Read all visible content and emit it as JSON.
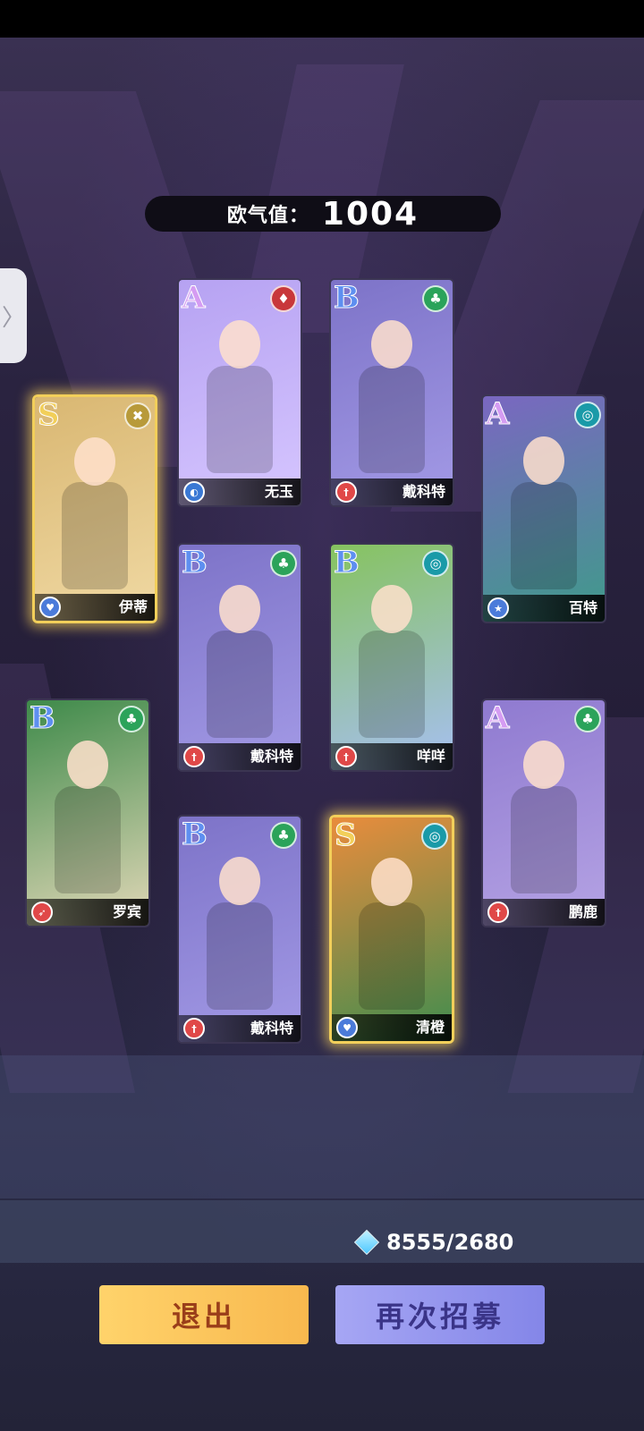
{
  "luck": {
    "label": "欧气值：",
    "value": "1004"
  },
  "cards": [
    {
      "rank": "A",
      "name": "无玉",
      "rank_color": "#d59cf2",
      "element": "fire",
      "element_color": "#c8373a",
      "class": "guard",
      "class_color": "#3a78d4",
      "art": [
        "#b6a2f2",
        "#d6c6ff"
      ]
    },
    {
      "rank": "B",
      "name": "戴科特",
      "rank_color": "#5e8ff0",
      "element": "nature",
      "element_color": "#2ba35a",
      "class": "melee",
      "class_color": "#e04848",
      "art": [
        "#7d73c8",
        "#a39ae6"
      ]
    },
    {
      "rank": "S",
      "name": "伊蒂",
      "rank_color": "#f2cf5a",
      "element": "gold",
      "element_color": "#b89a3a",
      "class": "heal",
      "class_color": "#4b7bda",
      "art": [
        "#d9b772",
        "#f0d9a3"
      ]
    },
    {
      "rank": "A",
      "name": "百特",
      "rank_color": "#d59cf2",
      "element": "wind",
      "element_color": "#1a9aa8",
      "class": "magic",
      "class_color": "#4b7bda",
      "art": [
        "#7a67c1",
        "#3f9b8a"
      ]
    },
    {
      "rank": "B",
      "name": "戴科特",
      "rank_color": "#5e8ff0",
      "element": "nature",
      "element_color": "#2ba35a",
      "class": "melee",
      "class_color": "#e04848",
      "art": [
        "#7d73c8",
        "#a39ae6"
      ]
    },
    {
      "rank": "B",
      "name": "咩咩",
      "rank_color": "#5e8ff0",
      "element": "wind",
      "element_color": "#1a9aa8",
      "class": "melee",
      "class_color": "#e04848",
      "art": [
        "#86c35f",
        "#a7bff3"
      ]
    },
    {
      "rank": "B",
      "name": "罗宾",
      "rank_color": "#5e8ff0",
      "element": "nature",
      "element_color": "#2ba35a",
      "class": "ranged",
      "class_color": "#e04848",
      "art": [
        "#3e8a4a",
        "#e2d8b8"
      ]
    },
    {
      "rank": "A",
      "name": "鹏鹿",
      "rank_color": "#d59cf2",
      "element": "nature",
      "element_color": "#2ba35a",
      "class": "melee",
      "class_color": "#e04848",
      "art": [
        "#8f7ad0",
        "#b5a3e4"
      ]
    },
    {
      "rank": "B",
      "name": "戴科特",
      "rank_color": "#5e8ff0",
      "element": "nature",
      "element_color": "#2ba35a",
      "class": "melee",
      "class_color": "#e04848",
      "art": [
        "#7d73c8",
        "#a39ae6"
      ]
    },
    {
      "rank": "S",
      "name": "清橙",
      "rank_color": "#f2cf5a",
      "element": "wind",
      "element_color": "#1a9aa8",
      "class": "heal",
      "class_color": "#4b7bda",
      "art": [
        "#e98c3c",
        "#3f8d4f"
      ]
    }
  ],
  "currency": {
    "icon": "diamond-icon",
    "value": "8555/2680"
  },
  "buttons": {
    "exit": "退出",
    "again": "再次招募"
  }
}
